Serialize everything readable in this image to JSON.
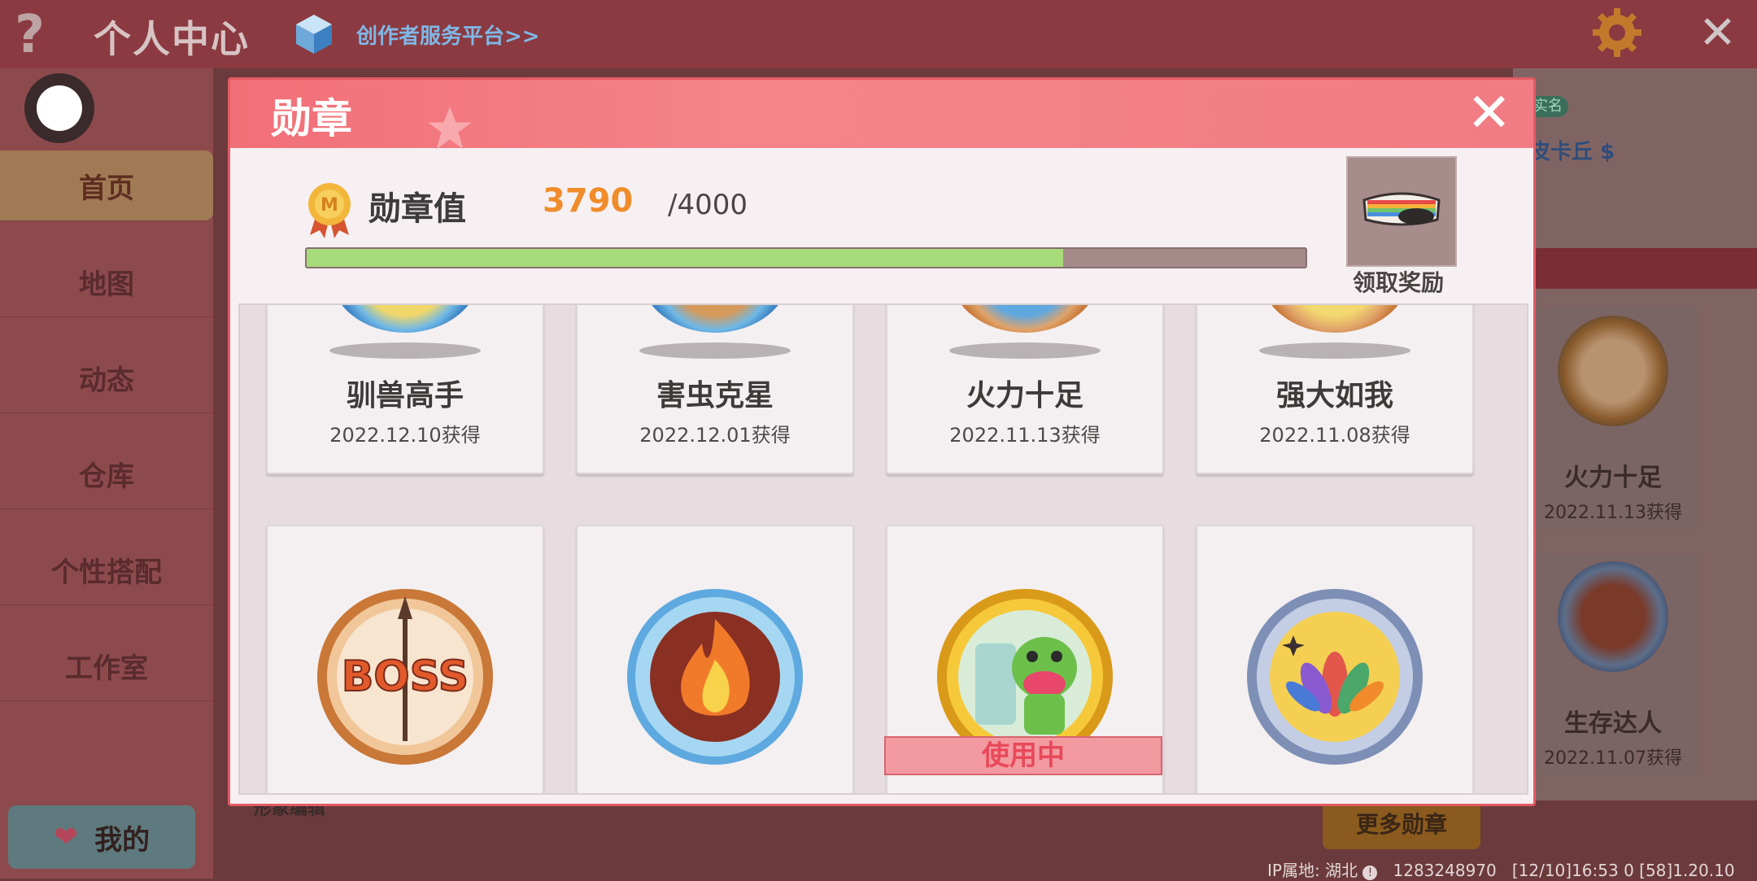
{
  "topbar": {
    "help_icon": "question-mark-icon",
    "title": "个人中心",
    "creator_link": "创作者服务平台>>",
    "settings_icon": "gear-icon",
    "close_icon": "close-icon"
  },
  "sidebar": {
    "items": [
      {
        "label": "首页",
        "active": true
      },
      {
        "label": "地图"
      },
      {
        "label": "动态"
      },
      {
        "label": "仓库"
      },
      {
        "label": "个性搭配"
      },
      {
        "label": "工作室"
      }
    ],
    "mine_label": "我的"
  },
  "background": {
    "badge_text": "实名",
    "name": "皮卡丘 $",
    "cards": [
      {
        "name": "火力十足",
        "date": "2022.11.13获得"
      },
      {
        "name": "生存达人",
        "date": "2022.11.07获得"
      }
    ],
    "more_medals_button": "更多勋章",
    "under_label": "形象编辑",
    "footer": {
      "ip_label": "IP属地: 湖北",
      "uid": "1283248970",
      "time": "[12/10]16:53 0",
      "version": "[58]1.20.10"
    }
  },
  "modal": {
    "title": "勋章",
    "medal_value_label": "勋章值",
    "medal_value": "3790",
    "medal_max": "/4000",
    "progress_fraction": 0.7575,
    "reward_label": "领取奖励",
    "cards_top_row": [
      {
        "name": "驯兽高手",
        "date": "2022.12.10获得"
      },
      {
        "name": "害虫克星",
        "date": "2022.12.01获得"
      },
      {
        "name": "火力十足",
        "date": "2022.11.13获得"
      },
      {
        "name": "强大如我",
        "date": "2022.11.08获得"
      }
    ],
    "cards_bottom_row": [
      {
        "medal": "boss-medal-icon"
      },
      {
        "medal": "fire-medal-icon"
      },
      {
        "medal": "dinosaur-medal-icon",
        "status": "使用中"
      },
      {
        "medal": "flower-medal-icon"
      }
    ]
  },
  "colors": {
    "modal_header": "#f16f78",
    "medal_value": "#f08c2a",
    "progress_fill": "#a7da78",
    "in_use": "#e8495a"
  }
}
